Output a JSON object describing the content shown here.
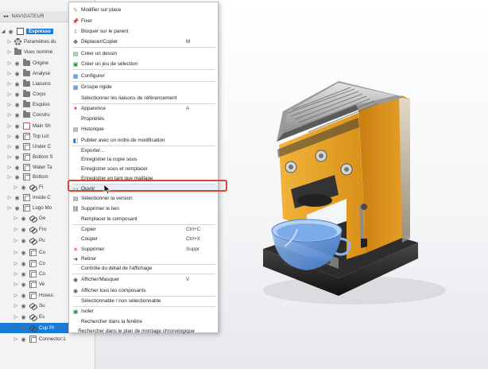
{
  "navigator": {
    "title": "NAVIGATEUR",
    "collapse_icon": "double-chevron-left-icon",
    "items": [
      {
        "label": "Espresso",
        "icon": "component-root-icon"
      },
      {
        "label": "Paramètres du",
        "icon": "gear-icon"
      },
      {
        "label": "Vues nommé",
        "icon": "folder-icon"
      },
      {
        "label": "Origine",
        "icon": "folder-icon"
      },
      {
        "label": "Analyse",
        "icon": "folder-icon"
      },
      {
        "label": "Liaisons",
        "icon": "folder-icon"
      },
      {
        "label": "Corps",
        "icon": "folder-icon"
      },
      {
        "label": "Esquiss",
        "icon": "folder-icon"
      },
      {
        "label": "Constru",
        "icon": "folder-icon"
      },
      {
        "label": "Main Sh",
        "icon": "sketch-icon"
      },
      {
        "label": "Top Lid",
        "icon": "component-icon"
      },
      {
        "label": "Under C",
        "icon": "component-icon"
      },
      {
        "label": "Bottom S",
        "icon": "component-icon"
      },
      {
        "label": "Water Ta",
        "icon": "component-icon"
      },
      {
        "label": "Bottom",
        "icon": "component-icon"
      },
      {
        "label": "Fi",
        "icon": "link-icon"
      },
      {
        "label": "Inside C",
        "icon": "component-icon"
      },
      {
        "label": "Logo Mo",
        "icon": "component-icon"
      },
      {
        "label": "Ge",
        "icon": "link-icon"
      },
      {
        "label": "Fro",
        "icon": "link-icon"
      },
      {
        "label": "Pu",
        "icon": "link-icon"
      },
      {
        "label": "Cu",
        "icon": "component-icon"
      },
      {
        "label": "Co",
        "icon": "component-icon"
      },
      {
        "label": "Co",
        "icon": "component-icon"
      },
      {
        "label": "Ve",
        "icon": "component-icon"
      },
      {
        "label": "Hoses:",
        "icon": "component-icon"
      },
      {
        "label": "Su",
        "icon": "link-icon"
      },
      {
        "label": "Es",
        "icon": "link-icon"
      },
      {
        "label": "Cup PI",
        "icon": "link-icon"
      },
      {
        "label": "Connector:1",
        "icon": "component-icon"
      }
    ]
  },
  "context_menu": {
    "items": [
      {
        "label": "Modifier sur place",
        "icon": "edit-in-place-icon",
        "shortcut": ""
      },
      {
        "label": "Fixer",
        "icon": "pin-icon",
        "shortcut": ""
      },
      {
        "label": "Bloquer sur le parent",
        "icon": "ground-icon",
        "shortcut": ""
      },
      {
        "label": "Déplacer/Copier",
        "icon": "move-icon",
        "shortcut": "M"
      },
      {
        "label": "Créer un dessin",
        "icon": "drawing-icon",
        "shortcut": ""
      },
      {
        "label": "Créer un jeu de sélection",
        "icon": "selection-set-icon",
        "shortcut": ""
      },
      {
        "label": "Configurer",
        "icon": "configure-icon",
        "shortcut": ""
      },
      {
        "label": "Groupe rigide",
        "icon": "rigid-group-icon",
        "shortcut": ""
      },
      {
        "label": "Sélectionner les liaisons de référencement",
        "icon": "",
        "shortcut": ""
      },
      {
        "label": "Apparence",
        "icon": "appearance-icon",
        "shortcut": "A"
      },
      {
        "label": "Propriétés",
        "icon": "",
        "shortcut": ""
      },
      {
        "label": "Historique",
        "icon": "history-icon",
        "shortcut": ""
      },
      {
        "label": "Publier avec un ordre de modification",
        "icon": "publish-icon",
        "shortcut": ""
      },
      {
        "label": "Exporter...",
        "icon": "",
        "shortcut": ""
      },
      {
        "label": "Enregistrer la copie sous",
        "icon": "",
        "shortcut": ""
      },
      {
        "label": "Enregistrer sous et remplacer",
        "icon": "",
        "shortcut": ""
      },
      {
        "label": "Enregistrer en tant que maillage",
        "icon": "",
        "shortcut": ""
      },
      {
        "label": "Ouvrir",
        "icon": "open-folder-icon",
        "shortcut": ""
      },
      {
        "label": "Sélectionner la version",
        "icon": "version-icon",
        "shortcut": ""
      },
      {
        "label": "Supprimer le lien",
        "icon": "break-link-icon",
        "shortcut": ""
      },
      {
        "label": "Remplacer le composant",
        "icon": "",
        "shortcut": ""
      },
      {
        "label": "Copier",
        "icon": "",
        "shortcut": "Ctrl+C"
      },
      {
        "label": "Couper",
        "icon": "",
        "shortcut": "Ctrl+X"
      },
      {
        "label": "Supprimer",
        "icon": "delete-icon",
        "shortcut": "Suppr"
      },
      {
        "label": "Retirer",
        "icon": "remove-icon",
        "shortcut": ""
      },
      {
        "label": "Contrôle du détail de l'affichage",
        "icon": "",
        "shortcut": ""
      },
      {
        "label": "Afficher/Masquer",
        "icon": "eye-icon",
        "shortcut": "V"
      },
      {
        "label": "Afficher tous les composants",
        "icon": "show-all-icon",
        "shortcut": ""
      },
      {
        "label": "Sélectionnable / non sélectionnable",
        "icon": "",
        "shortcut": ""
      },
      {
        "label": "Isoler",
        "icon": "isolate-icon",
        "shortcut": ""
      },
      {
        "label": "Rechercher dans la fenêtre",
        "icon": "",
        "shortcut": ""
      },
      {
        "label": "Rechercher dans le plan de montage chronologique",
        "icon": "",
        "shortcut": ""
      }
    ]
  },
  "colors": {
    "selection_blue": "#1a7bd6",
    "highlight_frame": "#d0492c",
    "machine_yellow": "#eaa327",
    "cup_blue": "#5e96e4"
  }
}
